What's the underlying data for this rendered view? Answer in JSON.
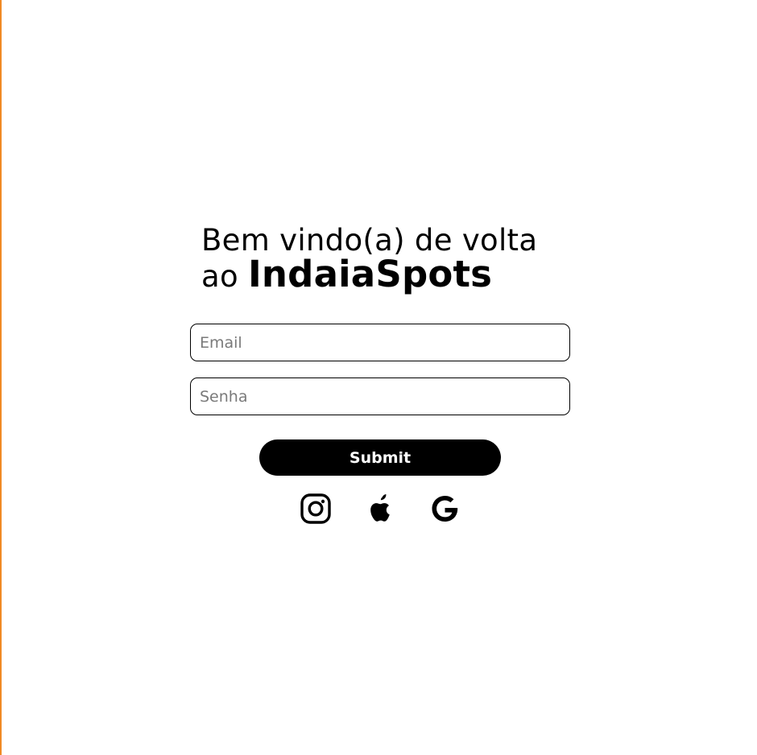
{
  "login": {
    "title_line1": "Bem vindo(a) de volta",
    "title_prefix": "ao",
    "brand_name": "IndaiaSpots",
    "email_placeholder": "Email",
    "email_value": "",
    "password_placeholder": "Senha",
    "password_value": "",
    "submit_label": "Submit"
  },
  "social": [
    {
      "icon": "instagram-icon"
    },
    {
      "icon": "apple-icon"
    },
    {
      "icon": "google-icon"
    }
  ],
  "colors": {
    "background": "#ffffff",
    "text": "#000000",
    "button_bg": "#000000",
    "button_text": "#ffffff",
    "left_border_accent": "#f08a24",
    "placeholder": "#7a7a7a"
  }
}
